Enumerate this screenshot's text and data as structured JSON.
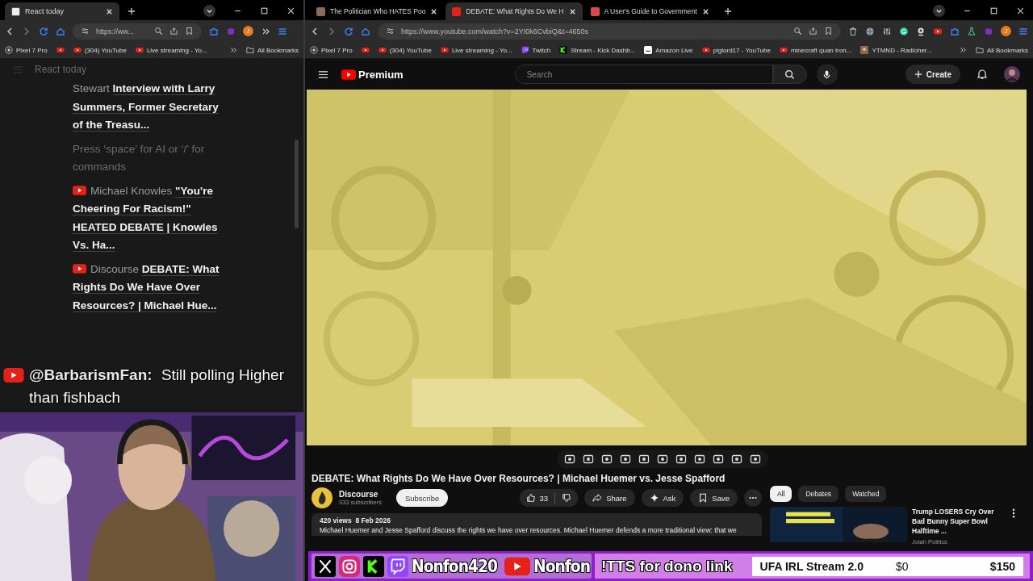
{
  "windows": [
    {
      "tabs": [
        {
          "title": "React today",
          "kind": "notion",
          "selected": true
        }
      ],
      "address": "https://ww...",
      "profile_initial": "J",
      "bookmarks": [
        {
          "label": "Pixel 7 Pro",
          "kind": "device"
        },
        {
          "kind": "video"
        },
        {
          "label": "(304) YouTube",
          "kind": "video"
        },
        {
          "label": "Live streaming - Yo...",
          "kind": "video"
        }
      ],
      "all_bookmarks": "All Bookmarks"
    },
    {
      "tabs": [
        {
          "title": "The Politician Who HATES Poo",
          "selected": false
        },
        {
          "title": "DEBATE: What Rights Do We H",
          "kind": "video",
          "selected": true
        },
        {
          "title": "A User's Guide to Government",
          "kind": "doc",
          "selected": false
        }
      ],
      "address": "https://www.youtube.com/watch?v=2YI0k6CvbiQ&t=4650s",
      "profile_initial": "J",
      "bookmarks": [
        {
          "label": "Pixel 7 Pro",
          "kind": "device"
        },
        {
          "kind": "video"
        },
        {
          "label": "(304) YouTube",
          "kind": "video"
        },
        {
          "label": "Live streaming - Yo...",
          "kind": "video"
        },
        {
          "label": "Twitch",
          "kind": "twitch"
        },
        {
          "label": "Stream - Kick Dashb...",
          "kind": "kick"
        },
        {
          "label": "Amazon Live",
          "kind": "amazon"
        },
        {
          "label": "piglord17 - YouTube",
          "kind": "video"
        },
        {
          "label": "minecraft quan tron...",
          "kind": "video"
        },
        {
          "label": "YTMND - Radioher..."
        }
      ],
      "all_bookmarks": "All Bookmarks"
    }
  ],
  "notes": {
    "page_title": "React today",
    "entries": [
      {
        "kind": "text",
        "text": "Stewart **Interview with Larry Summers, Former Secretary of the Treasu...**"
      },
      {
        "kind": "placeholder",
        "text": "Press ‘space’ for AI or ‘/’ for commands"
      },
      {
        "kind": "video",
        "text": "Michael Knowles **\"You're Cheering For Racism!\" HEATED DEBATE | Knowles Vs. Ha...**"
      },
      {
        "kind": "video",
        "text": "Discourse **DEBATE: What Rights Do We Have Over Resources? | Michael Hue...**"
      }
    ]
  },
  "chat": {
    "user": "@BarbarismFan:",
    "message": "Still polling Higher than fishbach"
  },
  "youtube": {
    "logo": "Premium",
    "search": {
      "placeholder": "Search"
    },
    "create": "Create",
    "title": "DEBATE: What Rights Do We Have Over Resources? | Michael Huemer vs. Jesse Spafford",
    "channel": "Discourse",
    "subscribers": "333 subscribers",
    "subscribe": "Subscribe",
    "likes": "33",
    "share": "Share",
    "ask": "Ask",
    "save": "Save",
    "stats": "420 views  8 Feb 2026",
    "description": "Michael Huemer and Jesse Spafford discuss the rights we have over resources. Michael Huemer defends a more traditional view: that we",
    "chips": [
      {
        "label": "All",
        "selected": true
      },
      {
        "label": "Debates",
        "selected": false
      },
      {
        "label": "Watched",
        "selected": false
      }
    ],
    "recommended": [
      {
        "title": "Trump LOSERS Cry Over Bad Bunny Super Bowl Halftime ...",
        "channel": "Jolah Politics"
      }
    ]
  },
  "overlay": {
    "handles": [
      "Nonfon420",
      "Nonfon"
    ],
    "tts": "!TTS for dono link",
    "goal": {
      "name": "UFA IRL Stream 2.0",
      "current": "$0",
      "target": "$150",
      "level": 0
    }
  }
}
